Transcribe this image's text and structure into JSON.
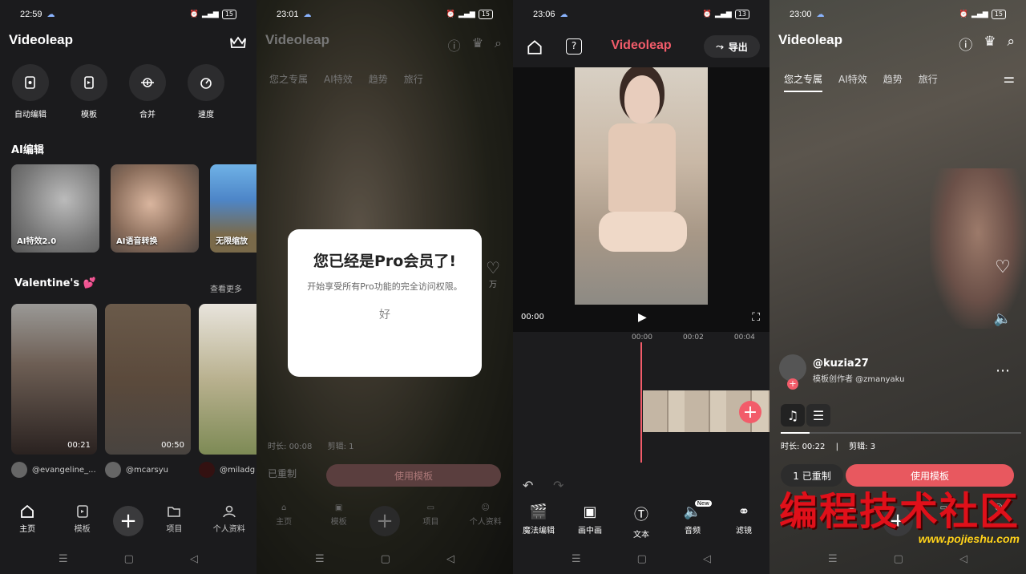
{
  "p1": {
    "status": {
      "time": "22:59",
      "battery": "15"
    },
    "brand": "Videoleap",
    "tools": [
      {
        "label": "自动编辑"
      },
      {
        "label": "模板"
      },
      {
        "label": "合并"
      },
      {
        "label": "速度"
      }
    ],
    "ai_section": "AI编辑",
    "ai_cards": [
      {
        "label": "AI特效2.0"
      },
      {
        "label": "AI语音转换"
      },
      {
        "label": "无限缩放"
      }
    ],
    "valentine_section": "Valentine's 💕",
    "see_more": "查看更多",
    "videos": [
      {
        "duration": "00:21",
        "user": "@evangeline_..."
      },
      {
        "duration": "00:50",
        "user": "@mcarsyu"
      },
      {
        "duration": "",
        "user": "@miladg"
      }
    ],
    "tabs": [
      {
        "label": "主页"
      },
      {
        "label": "模板"
      },
      {
        "label": "项目"
      },
      {
        "label": "个人资料"
      }
    ]
  },
  "p2": {
    "status": {
      "time": "23:01",
      "battery": "15"
    },
    "brand": "Videoleap",
    "tabs": [
      "您之专属",
      "AI特效",
      "趋势",
      "旅行"
    ],
    "dialog": {
      "title": "您已经是Pro会员了!",
      "body": "开始享受所有Pro功能的完全访问权限。",
      "ok": "好"
    },
    "likes": "万",
    "duration_label": "时长:",
    "duration": "00:08",
    "clips_label": "剪辑:",
    "clips": "1",
    "remix": "已重制",
    "use_template": "使用模板",
    "bottom_tabs": [
      {
        "label": "主页"
      },
      {
        "label": "模板"
      },
      {
        "label": "项目"
      },
      {
        "label": "个人资料"
      }
    ]
  },
  "p3": {
    "status": {
      "time": "23:06",
      "battery": "13"
    },
    "brand": "Videoleap",
    "export": "导出",
    "time_current": "00:00",
    "ruler": [
      "00:00",
      "00:02",
      "00:04"
    ],
    "toolbar": [
      {
        "label": "魔法编辑"
      },
      {
        "label": "画中画"
      },
      {
        "label": "文本"
      },
      {
        "label": "音频",
        "badge": "New"
      },
      {
        "label": "滤镜"
      }
    ]
  },
  "p4": {
    "status": {
      "time": "23:00",
      "battery": "15"
    },
    "brand": "Videoleap",
    "tabs": [
      "您之专属",
      "AI特效",
      "趋势",
      "旅行"
    ],
    "username": "@kuzia27",
    "creator_label": "模板创作者 @zmanyaku",
    "duration_label": "时长:",
    "duration": "00:22",
    "clips_label": "剪辑:",
    "clips": "3",
    "remix": "1 已重制",
    "use_template": "使用模板",
    "watermark": "编程技术社区",
    "watermark_url": "www.pojieshu.com"
  },
  "colors": {
    "accent": "#f25c6a",
    "button": "#e8585f"
  }
}
